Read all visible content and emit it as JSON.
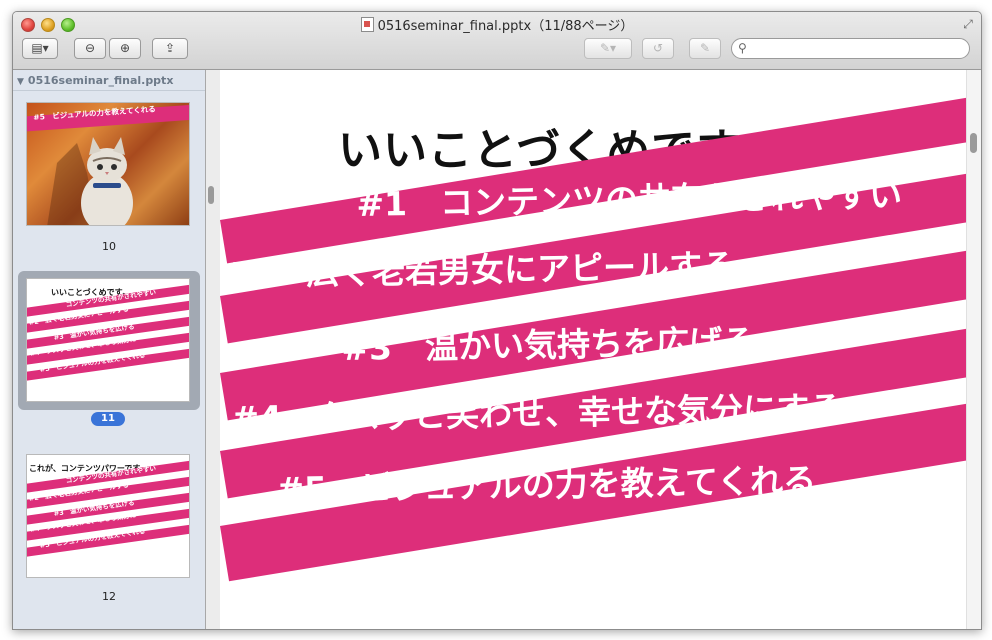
{
  "window": {
    "title": "0516seminar_final.pptx（11/88ページ）",
    "icons": [
      "document-icon",
      "fullscreen-icon"
    ]
  },
  "toolbar": {
    "view_icon": "▤▾",
    "zoom_out": "−",
    "zoom_in": "+",
    "share": "⇪",
    "annotate": "✎▾",
    "rotate": "↺",
    "edit": "✎",
    "search_placeholder": ""
  },
  "sidebar": {
    "doc_name": "0516seminar_final.pptx",
    "pages": [
      {
        "label": "10",
        "title": "#5　ビジュアルの力を教えてくれる"
      },
      {
        "label": "11",
        "selected": true,
        "title": "いいことづくめです。"
      },
      {
        "label": "12",
        "title": "これが、コンテンツパワーです。"
      }
    ]
  },
  "slide": {
    "title": "いいことづくめです。",
    "items": [
      "#1　コンテンツの共有がされやすい",
      "#2　広く老若男女にアピールする",
      "#3　温かい気持ちを広げる",
      "#4　クスッと笑わせ、幸せな気分にする",
      "#5　ビジュアルの力を教えてくれる"
    ],
    "accent_color": "#dd2e7a"
  },
  "thumb10": {
    "band_text": "#5　ビジュアルの力を教えてくれる"
  },
  "thumb11": {
    "title": "いいことづくめです。",
    "bands": [
      "コンテンツの共有がされやすい",
      "#2　広く老若男女にアピールする",
      "#3　温かい気持ちを広げる",
      "#4　クスッと笑わせ、幸せな気分に",
      "#5　ビジュアルの力を教えてくれる"
    ]
  },
  "thumb12": {
    "title": "これが、コンテンツパワーです。",
    "bands": [
      "コンテンツの共有がされやすい",
      "#2　広く老若男女にアピールする",
      "#3　温かい気持ちを広げる",
      "#4　クスッと笑わせ、幸せな気分に",
      "#5　ビジュアルの力を教えてくれる"
    ]
  }
}
